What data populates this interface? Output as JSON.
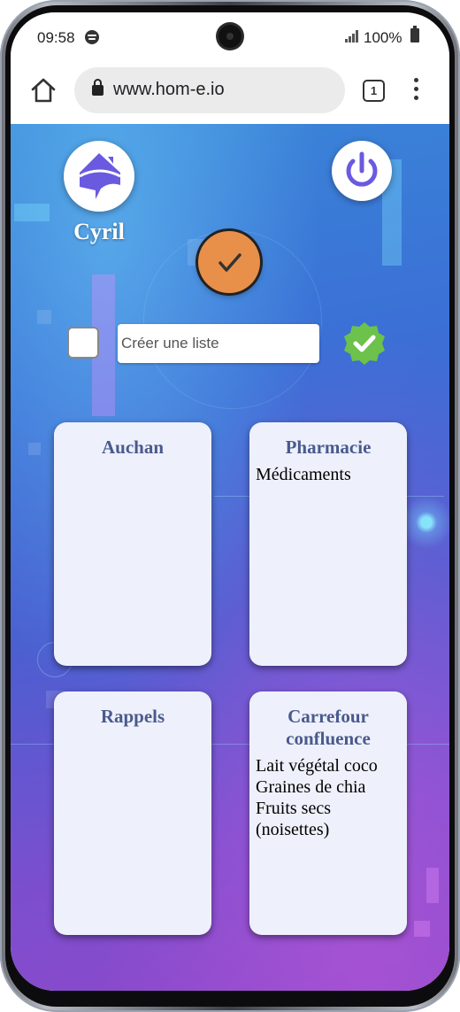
{
  "status_bar": {
    "time": "09:58",
    "battery": "100%"
  },
  "browser": {
    "url": "www.hom-e.io",
    "tab_count": "1"
  },
  "header": {
    "username": "Cyril"
  },
  "create_list": {
    "placeholder": "Créer une liste"
  },
  "lists": [
    {
      "title": "Auchan",
      "items": []
    },
    {
      "title": "Pharmacie",
      "items": [
        "Médicaments"
      ]
    },
    {
      "title": "Rappels",
      "items": []
    },
    {
      "title": "Carrefour confluence",
      "items": [
        "Lait végétal coco",
        "Graines de chia",
        "Fruits secs (noisettes)"
      ]
    }
  ],
  "colors": {
    "accent_orange": "#e8904a",
    "validate_green": "#6cc24a",
    "card_title": "#4a5a8e",
    "icon_purple": "#6a5ae0"
  }
}
